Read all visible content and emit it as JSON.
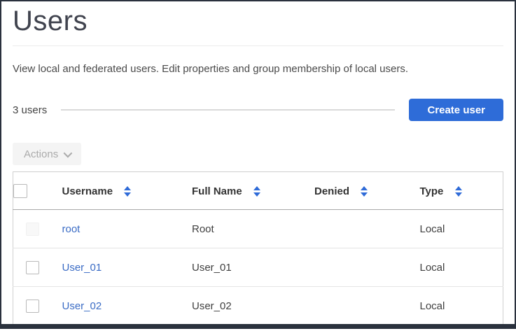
{
  "page": {
    "title": "Users",
    "description": "View local and federated users. Edit properties and group membership of local users.",
    "count_label": "3 users",
    "create_button_label": "Create user",
    "actions_button_label": "Actions"
  },
  "colors": {
    "primary_button_blue": "#2e6cd8",
    "link_blue": "#3b6cc5",
    "sort_arrow_blue": "#2f6bd8",
    "frame_border_dark": "#2a313d"
  },
  "table": {
    "columns": [
      "Username",
      "Full Name",
      "Denied",
      "Type"
    ],
    "rows": [
      {
        "username": "root",
        "full_name": "Root",
        "denied": "",
        "type": "Local",
        "checkbox_disabled": true
      },
      {
        "username": "User_01",
        "full_name": "User_01",
        "denied": "",
        "type": "Local",
        "checkbox_disabled": false
      },
      {
        "username": "User_02",
        "full_name": "User_02",
        "denied": "",
        "type": "Local",
        "checkbox_disabled": false
      }
    ]
  }
}
